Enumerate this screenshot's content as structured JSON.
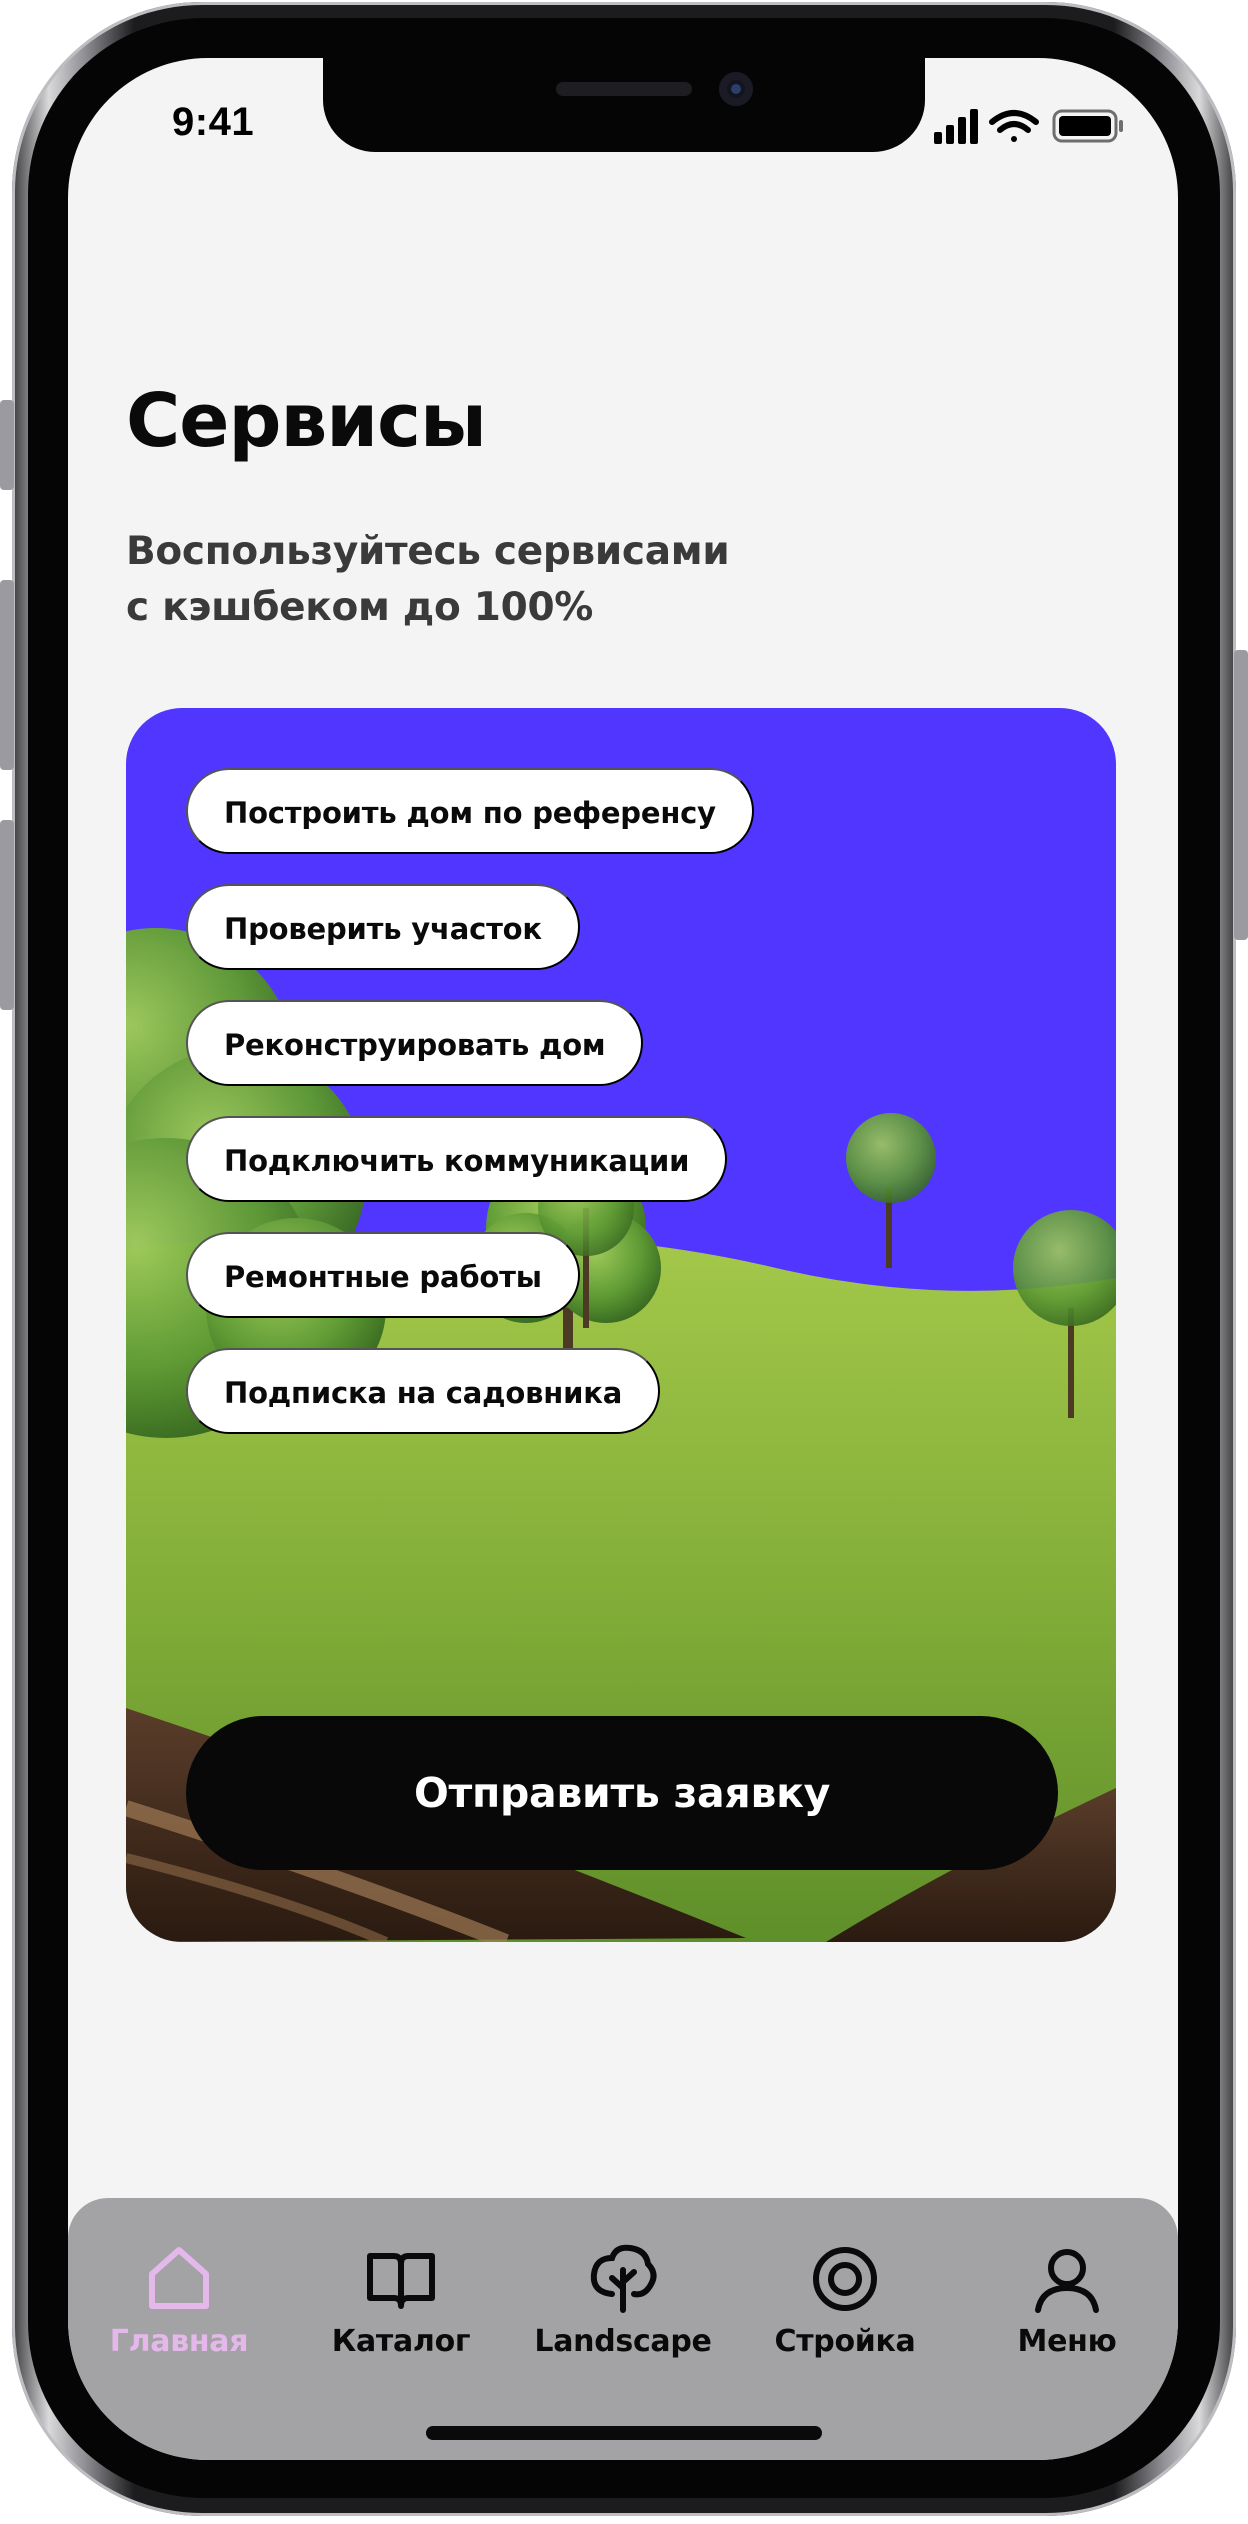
{
  "status_bar": {
    "time": "9:41",
    "icons": [
      "signal-icon",
      "wifi-icon",
      "battery-icon"
    ]
  },
  "header": {
    "title": "Сервисы",
    "subtitle_line1": "Воспользуйтесь сервисами",
    "subtitle_line2": "с кэшбеком до 100%"
  },
  "services": {
    "accent_color": "#5136ff",
    "items": [
      {
        "label": "Построить дом по референсу"
      },
      {
        "label": "Проверить участок"
      },
      {
        "label": "Реконструировать дом"
      },
      {
        "label": "Подключить коммуникации"
      },
      {
        "label": "Ремонтные работы"
      },
      {
        "label": "Подписка на садовника"
      }
    ],
    "submit_label": "Отправить заявку"
  },
  "tab_bar": {
    "active_color": "#e4b8ea",
    "tabs": [
      {
        "label": "Главная",
        "icon": "home-icon",
        "active": true
      },
      {
        "label": "Каталог",
        "icon": "book-icon",
        "active": false
      },
      {
        "label": "Landscape",
        "icon": "tree-icon",
        "active": false
      },
      {
        "label": "Стройка",
        "icon": "target-icon",
        "active": false
      },
      {
        "label": "Меню",
        "icon": "user-icon",
        "active": false
      }
    ]
  }
}
